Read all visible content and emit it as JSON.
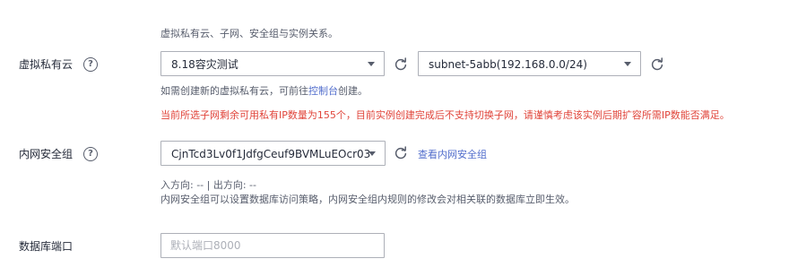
{
  "vpc_section": {
    "top_hint": "虚拟私有云、子网、安全组与实例关系。",
    "label": "虚拟私有云",
    "vpc_select_value": "8.18容灾测试",
    "subnet_select_value": "subnet-5abb(192.168.0.0/24)",
    "create_hint_prefix": "如需创建新的虚拟私有云，可前往",
    "create_hint_link": "控制台",
    "create_hint_suffix": "创建。",
    "warning": "当前所选子网剩余可用私有IP数量为155个，目前实例创建完成后不支持切换子网，请谨慎考虑该实例后期扩容所需IP数能否满足。"
  },
  "security_group_section": {
    "label": "内网安全组",
    "select_value": "CjnTcd3Lv0f1JdfgCeuf9BVMLuEOcr03",
    "view_link": "查看内网安全组",
    "direction_info": "入方向: -- | 出方向: --",
    "description": "内网安全组可以设置数据库访问策略，内网安全组内规则的修改会对相关联的数据库立即生效。"
  },
  "port_section": {
    "label": "数据库端口",
    "placeholder": "默认端口8000",
    "value": ""
  },
  "icons": {
    "help": "question-circle-icon",
    "refresh": "refresh-icon",
    "dropdown": "caret-down-icon"
  },
  "colors": {
    "text": "#252b3a",
    "hint": "#575d6c",
    "link": "#526ecc",
    "warning": "#e0443a",
    "border": "#adb0b8"
  }
}
